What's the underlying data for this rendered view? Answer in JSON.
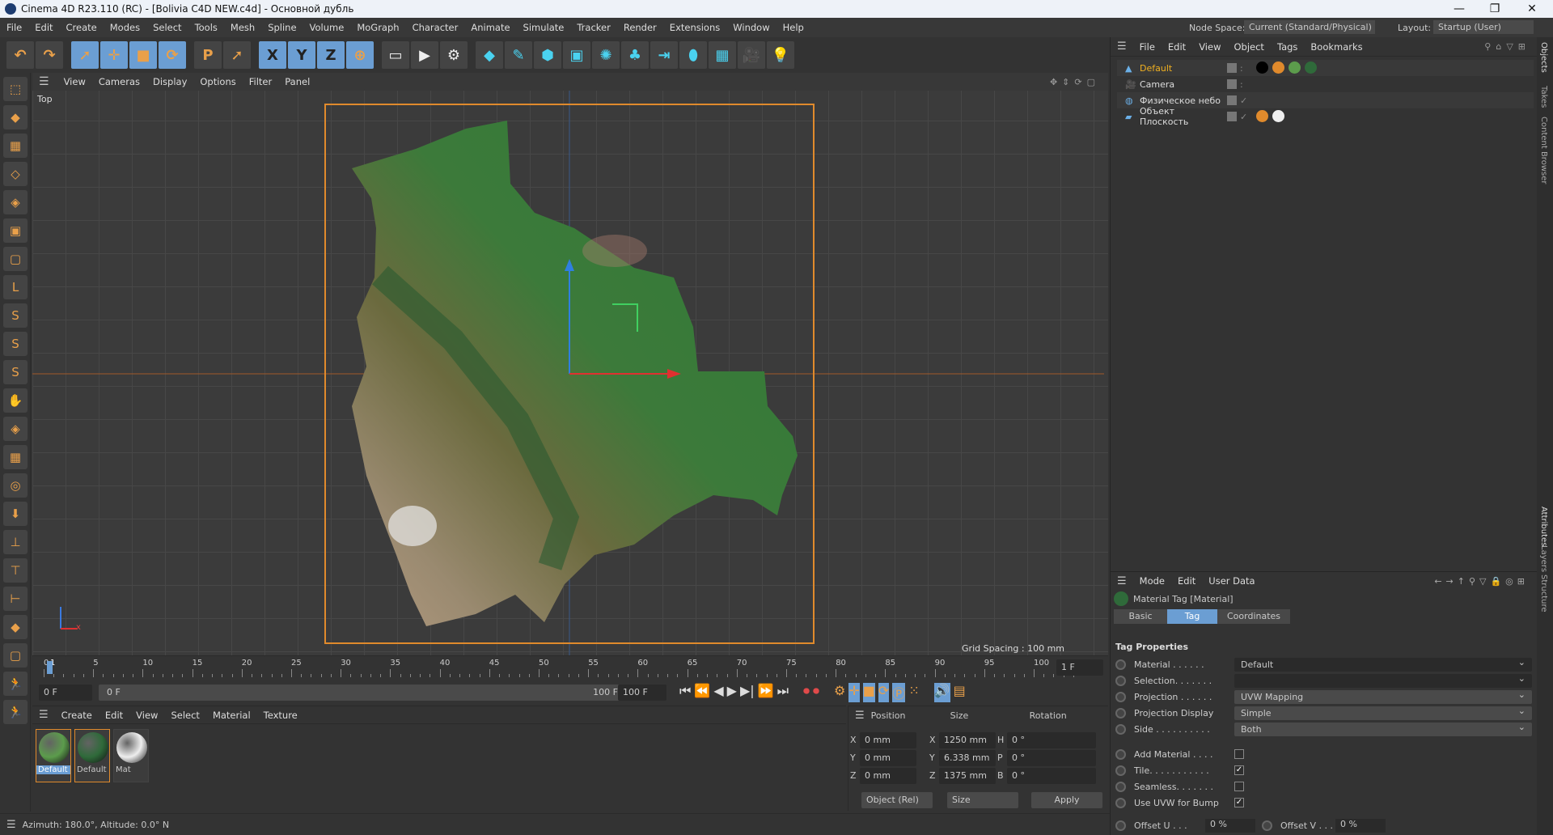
{
  "window": {
    "title": "Cinema 4D R23.110 (RC) - [Bolivia C4D NEW.c4d] - Основной дубль",
    "minimize": "—",
    "maximize": "❐",
    "close": "✕"
  },
  "menu": [
    "File",
    "Edit",
    "Create",
    "Modes",
    "Select",
    "Tools",
    "Mesh",
    "Spline",
    "Volume",
    "MoGraph",
    "Character",
    "Animate",
    "Simulate",
    "Tracker",
    "Render",
    "Extensions",
    "Window",
    "Help"
  ],
  "nodespace": {
    "label": "Node Space:",
    "value": "Current (Standard/Physical)"
  },
  "layout": {
    "label": "Layout:",
    "value": "Startup (User)"
  },
  "toolbar_icons": [
    "undo-icon",
    "redo-icon",
    "select-live-icon",
    "move-icon",
    "scale-icon",
    "rotate-icon",
    "psr-icon",
    "last-tool-icon",
    "x-axis-icon",
    "y-axis-icon",
    "z-axis-icon",
    "world-coord-icon",
    "render-view-icon",
    "render-picture-viewer-icon",
    "render-settings-icon",
    "cube-icon",
    "pen-icon",
    "subdivision-icon",
    "extrude-icon",
    "cloner-icon",
    "mograph-array-icon",
    "symmetry-icon",
    "deformer-icon",
    "floor-icon",
    "camera-icon",
    "light-icon"
  ],
  "viewport": {
    "menu": [
      "View",
      "Cameras",
      "Display",
      "Options",
      "Filter",
      "Panel"
    ],
    "view_name": "Top",
    "grid_spacing": "Grid Spacing : 100 mm",
    "axis_x": "x"
  },
  "timeline": {
    "ticks": [
      "0",
      "5",
      "10",
      "15",
      "20",
      "25",
      "30",
      "35",
      "40",
      "45",
      "50",
      "55",
      "60",
      "65",
      "70",
      "75",
      "80",
      "85",
      "90",
      "95",
      "100"
    ],
    "current_frame": "1",
    "frame_field": "1 F",
    "start": "0 F",
    "range_start": "0 F",
    "range_end": "100 F",
    "end": "100 F"
  },
  "materials": {
    "menu": [
      "Create",
      "Edit",
      "View",
      "Select",
      "Material",
      "Texture"
    ],
    "items": [
      {
        "name": "Default",
        "color": "#5c9c4c"
      },
      {
        "name": "Default",
        "color": "#2f6a3a"
      },
      {
        "name": "Mat",
        "color": "#eeeeee"
      }
    ]
  },
  "coordinates": {
    "headers": [
      "Position",
      "Size",
      "Rotation"
    ],
    "rows": [
      {
        "axis": "X",
        "pos": "0 mm",
        "saxis": "X",
        "size": "1250 mm",
        "raxis": "H",
        "rot": "0 °"
      },
      {
        "axis": "Y",
        "pos": "0 mm",
        "saxis": "Y",
        "size": "6.338 mm",
        "raxis": "P",
        "rot": "0 °"
      },
      {
        "axis": "Z",
        "pos": "0 mm",
        "saxis": "Z",
        "size": "1375 mm",
        "raxis": "B",
        "rot": "0 °"
      }
    ],
    "mode": "Object (Rel)",
    "size_mode": "Size",
    "apply": "Apply"
  },
  "status": "Azimuth: 180.0°, Altitude: 0.0°  N",
  "objects": {
    "menu": [
      "File",
      "Edit",
      "View",
      "Object",
      "Tags",
      "Bookmarks"
    ],
    "items": [
      {
        "name": "Default",
        "active": true
      },
      {
        "name": "Camera"
      },
      {
        "name": "Физическое небо"
      },
      {
        "name": "Объект Плоскость"
      }
    ]
  },
  "side_tabs": [
    "Objects",
    "Takes",
    "Content Browser",
    "Attributes",
    "Layers",
    "Structure"
  ],
  "attributes": {
    "menu": [
      "Mode",
      "Edit",
      "User Data"
    ],
    "title": "Material Tag [Material]",
    "tabs": [
      "Basic",
      "Tag",
      "Coordinates"
    ],
    "active_tab": "Tag",
    "section": "Tag Properties",
    "material": {
      "label": "Material . . . . . .",
      "value": "Default"
    },
    "selection": {
      "label": "Selection. . . . . . .",
      "value": ""
    },
    "projection": {
      "label": "Projection . . . . . .",
      "value": "UVW Mapping"
    },
    "projection_display": {
      "label": "Projection Display",
      "value": "Simple"
    },
    "side": {
      "label": "Side . . . . . . . . . .",
      "value": "Both"
    },
    "checks": [
      {
        "label": "Add Material . . . .",
        "checked": false
      },
      {
        "label": "Tile. . . . . . . . . . .",
        "checked": true
      },
      {
        "label": "Seamless. . . . . . .",
        "checked": false
      },
      {
        "label": "Use UVW for Bump",
        "checked": true
      }
    ],
    "offset_u": {
      "label": "Offset U . . .",
      "value": "0 %"
    },
    "offset_v": {
      "label": "Offset V . . .",
      "value": "0 %"
    }
  }
}
